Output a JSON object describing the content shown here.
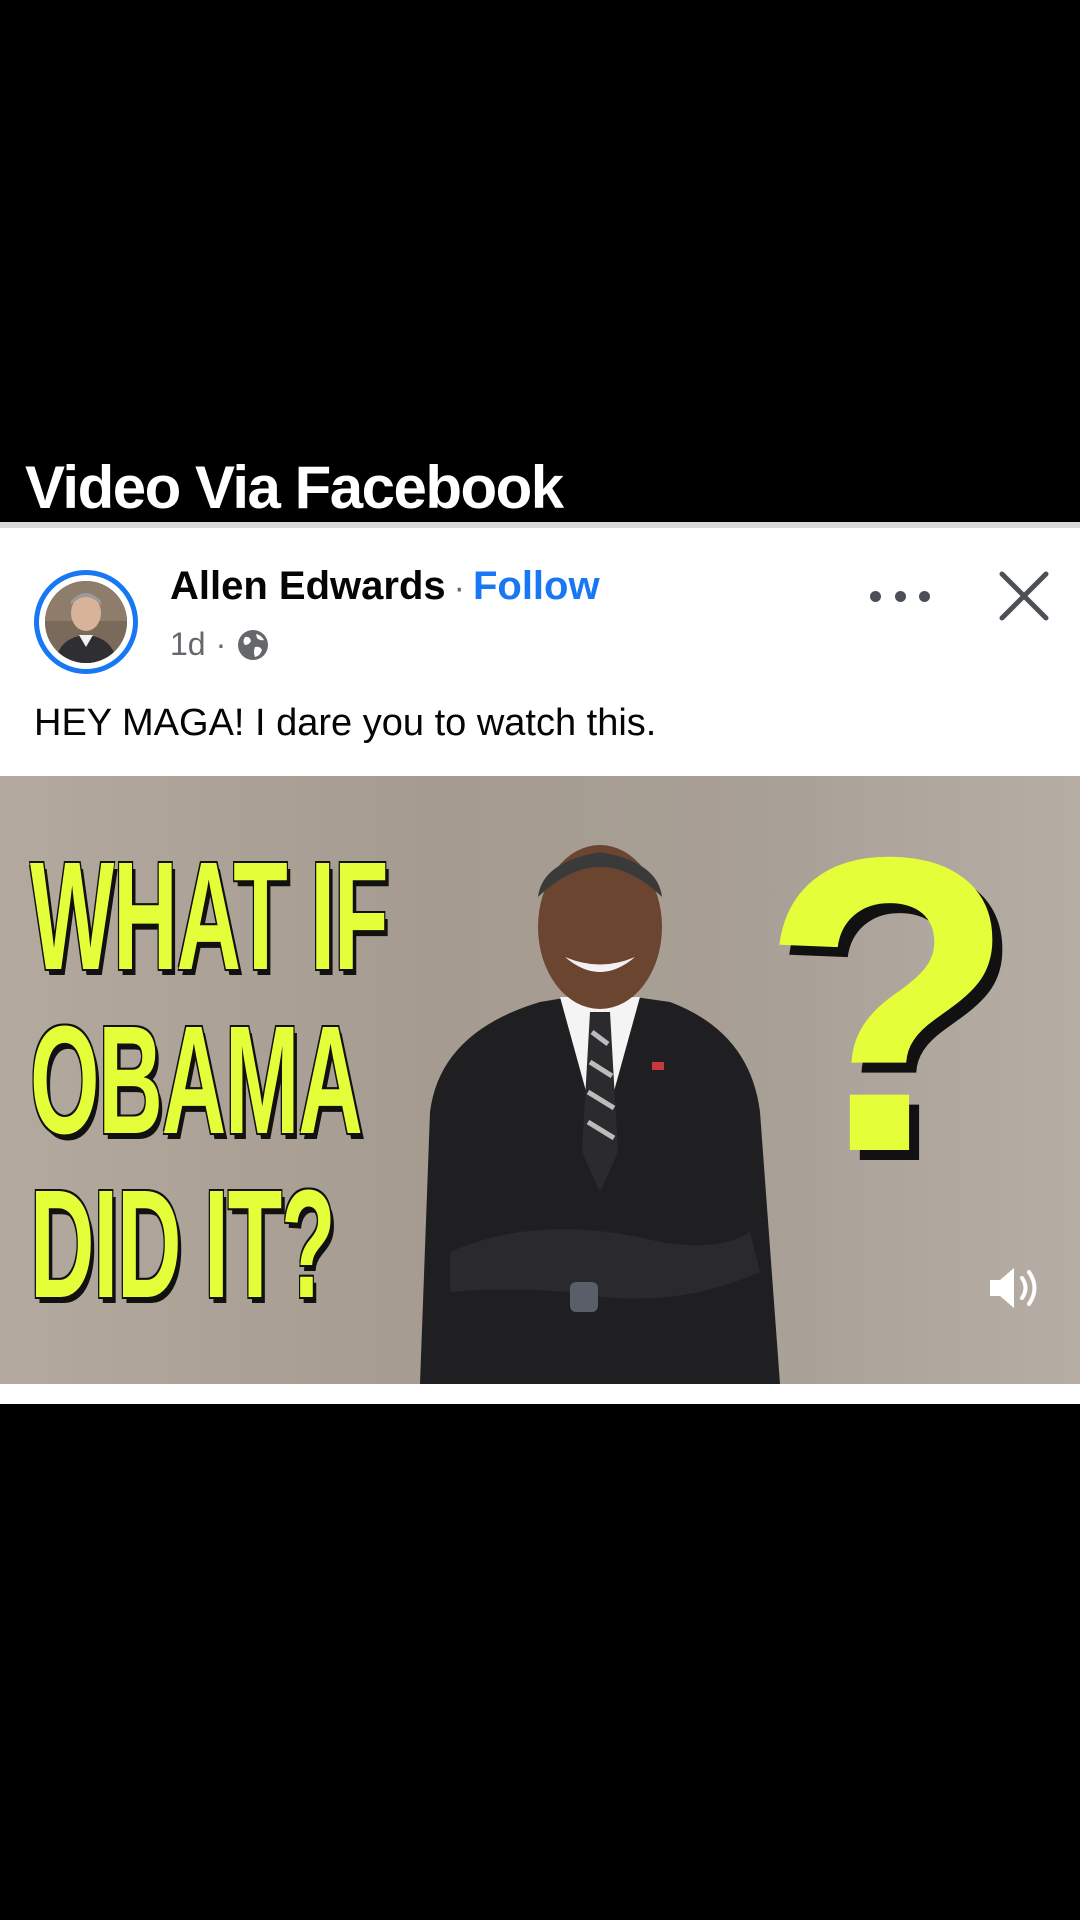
{
  "caption": "Video Via Facebook",
  "post": {
    "author": "Allen Edwards",
    "separator": "·",
    "follow_label": "Follow",
    "time": "1d",
    "meta_separator": "·",
    "audience_icon": "globe-icon",
    "text": "HEY MAGA!  I dare you to watch this.",
    "more_icon": "more-options-icon",
    "close_icon": "close-icon"
  },
  "video": {
    "thumbnail_lines": [
      "WHAT IF",
      "OBAMA",
      "DID IT?"
    ],
    "thumbnail_symbol": "?",
    "volume_icon": "volume-icon"
  },
  "colors": {
    "accent": "#1877f2",
    "thumbnail_text": "#e4ff3a"
  }
}
